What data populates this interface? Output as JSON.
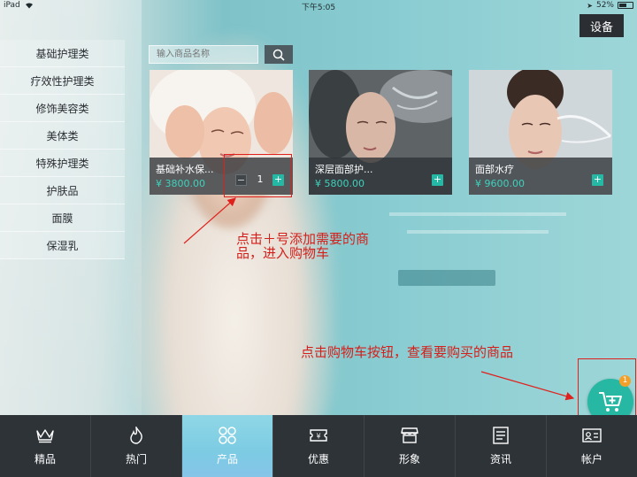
{
  "status_bar": {
    "device": "iPad",
    "time": "下午5:05",
    "battery": "52%"
  },
  "header": {
    "settings_label": "设备"
  },
  "sidebar": {
    "items": [
      {
        "label": "基础护理类",
        "active": true
      },
      {
        "label": "疗效性护理类",
        "active": false
      },
      {
        "label": "修饰美容类",
        "active": false
      },
      {
        "label": "美体类",
        "active": false
      },
      {
        "label": "特殊护理类",
        "active": false
      },
      {
        "label": "护肤品",
        "active": false
      },
      {
        "label": "面膜",
        "active": false
      },
      {
        "label": "保湿乳",
        "active": false
      }
    ]
  },
  "search": {
    "placeholder": "输入商品名称"
  },
  "products": [
    {
      "name": "基础补水保...",
      "price": "3800.00",
      "quantity": "1"
    },
    {
      "name": "深层面部护...",
      "price": "5800.00"
    },
    {
      "name": "面部水疗",
      "price": "9600.00"
    }
  ],
  "currency_symbol": "¥",
  "annotations": {
    "add_line1": "点击＋号添加需要的商",
    "add_line2": "品，进入购物车",
    "cart_hint": "点击购物车按钮，查看要购买的商品"
  },
  "cart": {
    "badge": "1"
  },
  "tabbar": {
    "tabs": [
      {
        "label": "精品",
        "icon": "crown-icon"
      },
      {
        "label": "热门",
        "icon": "flame-icon"
      },
      {
        "label": "产品",
        "icon": "product-grid-icon",
        "active": true
      },
      {
        "label": "优惠",
        "icon": "coupon-icon"
      },
      {
        "label": "形象",
        "icon": "store-icon"
      },
      {
        "label": "资讯",
        "icon": "news-icon"
      },
      {
        "label": "帐户",
        "icon": "account-card-icon"
      }
    ]
  },
  "colors": {
    "accent": "#27b8a3",
    "price": "#3ed2bd",
    "annotation": "#e0201c",
    "tabbar_bg": "#2e3338",
    "badge": "#f2a02a"
  }
}
